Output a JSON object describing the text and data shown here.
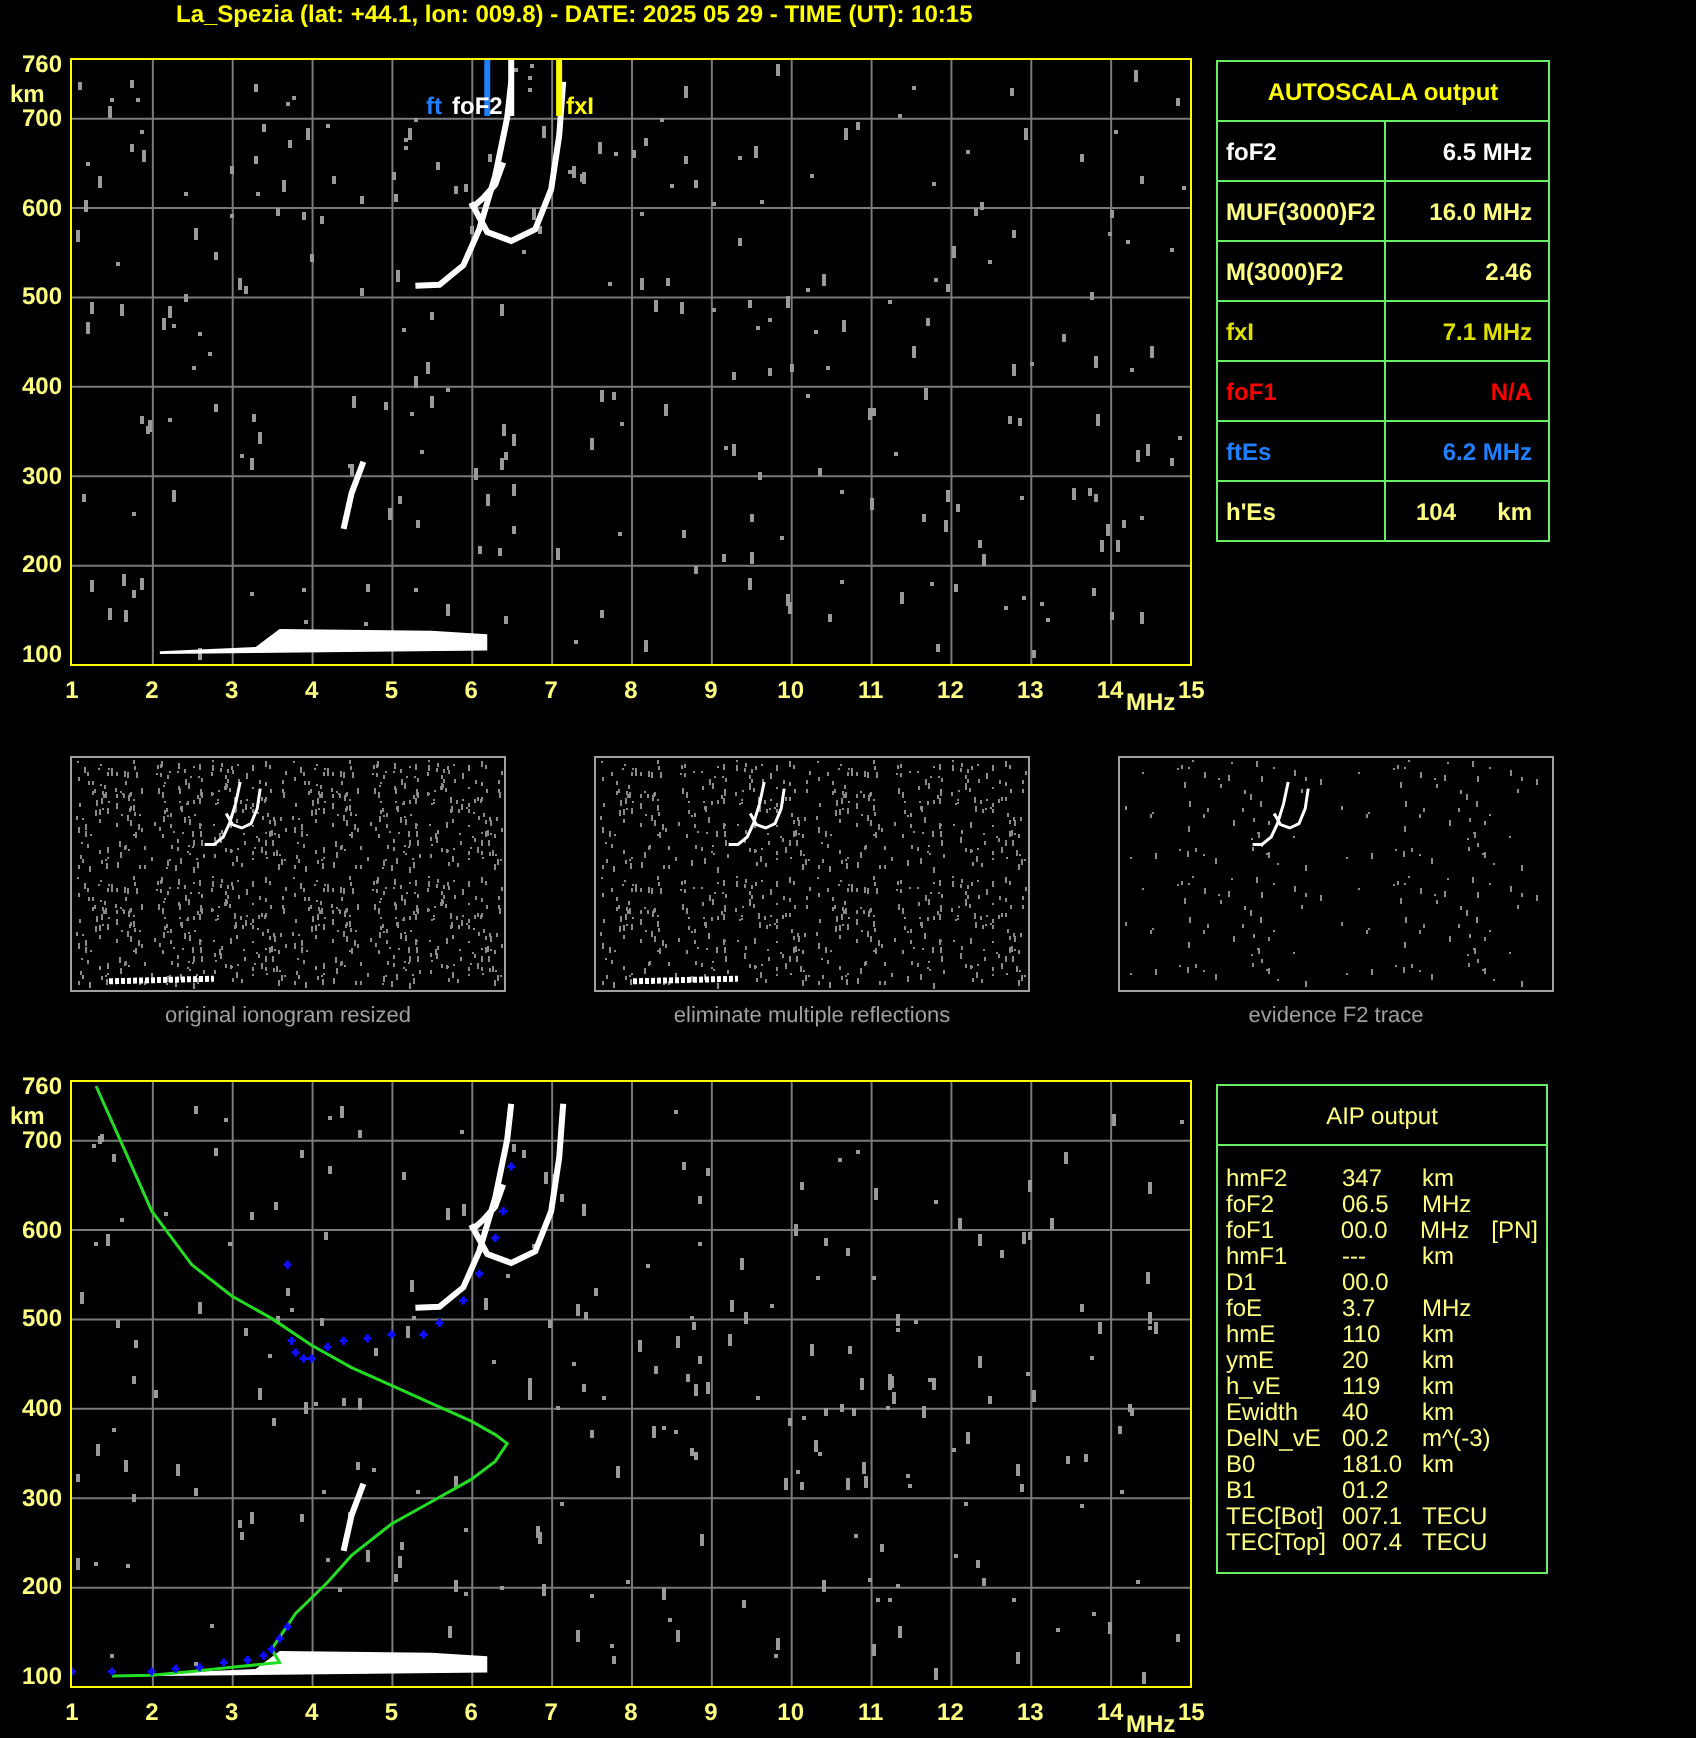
{
  "title": "La_Spezia (lat: +44.1, lon: 009.8) - DATE: 2025 05 29 - TIME (UT): 10:15",
  "plots": [
    {
      "kind": "ionogram",
      "y_ticks": [
        "760",
        "700",
        "600",
        "500",
        "400",
        "300",
        "200",
        "100"
      ],
      "y_unit": "km",
      "x_ticks": [
        "1",
        "2",
        "3",
        "4",
        "5",
        "6",
        "7",
        "8",
        "9",
        "10",
        "11",
        "12",
        "13",
        "14"
      ],
      "x_unit": "MHz",
      "x_end": "15",
      "markers": [
        {
          "label": "ft",
          "color": "#1e7fff"
        },
        {
          "label": "foF2",
          "color": "#ffffff"
        },
        {
          "label": "fxI",
          "color": "#ffff00"
        }
      ]
    },
    {
      "kind": "profile",
      "y_ticks": [
        "760",
        "700",
        "600",
        "500",
        "400",
        "300",
        "200",
        "100"
      ],
      "y_unit": "km",
      "x_ticks": [
        "1",
        "2",
        "3",
        "4",
        "5",
        "6",
        "7",
        "8",
        "9",
        "10",
        "11",
        "12",
        "13",
        "14"
      ],
      "x_unit": "MHz",
      "x_end": "15"
    }
  ],
  "autoscala": {
    "title": "AUTOSCALA output",
    "rows": [
      {
        "name": "foF2",
        "value": "6.5 MHz",
        "color": "#ffffff"
      },
      {
        "name": "MUF(3000)F2",
        "value": "16.0 MHz",
        "color": "#ffff80"
      },
      {
        "name": "M(3000)F2",
        "value": "2.46",
        "color": "#ffff80"
      },
      {
        "name": "fxI",
        "value": "7.1 MHz",
        "color": "#e0e000"
      },
      {
        "name": "foF1",
        "value": "N/A",
        "color": "#ff0000"
      },
      {
        "name": "ftEs",
        "value": "6.2 MHz",
        "color": "#1e7fff"
      },
      {
        "name": "h'Es",
        "value": "104",
        "unit": "km",
        "color": "#ffff80"
      }
    ]
  },
  "thumbnails": [
    {
      "caption": "original ionogram resized"
    },
    {
      "caption": "eliminate multiple reflections"
    },
    {
      "caption": "evidence F2 trace"
    }
  ],
  "aip": {
    "title": "AIP output",
    "rows": [
      {
        "name": "hmF2",
        "value": "347",
        "unit": "km"
      },
      {
        "name": "foF2",
        "value": "06.5",
        "unit": "MHz"
      },
      {
        "name": "foF1",
        "value": "00.0",
        "unit": "MHz",
        "note": "[PN]"
      },
      {
        "name": "hmF1",
        "value": "---",
        "unit": "km"
      },
      {
        "name": "D1",
        "value": "00.0"
      },
      {
        "name": "foE",
        "value": "3.7",
        "unit": "MHz"
      },
      {
        "name": "hmE",
        "value": "110",
        "unit": "km"
      },
      {
        "name": "ymE",
        "value": "20",
        "unit": "km"
      },
      {
        "name": "h_vE",
        "value": "119",
        "unit": "km"
      },
      {
        "name": "Ewidth",
        "value": "40",
        "unit": "km"
      },
      {
        "name": "DelN_vE",
        "value": "00.2",
        "unit": "m^(-3)"
      },
      {
        "name": "B0",
        "value": "181.0",
        "unit": "km"
      },
      {
        "name": "B1",
        "value": "01.2"
      },
      {
        "name": "TEC[Bot]",
        "value": "007.1",
        "unit": "TECU"
      },
      {
        "name": "TEC[Top]",
        "value": "007.4",
        "unit": "TECU"
      }
    ]
  }
}
